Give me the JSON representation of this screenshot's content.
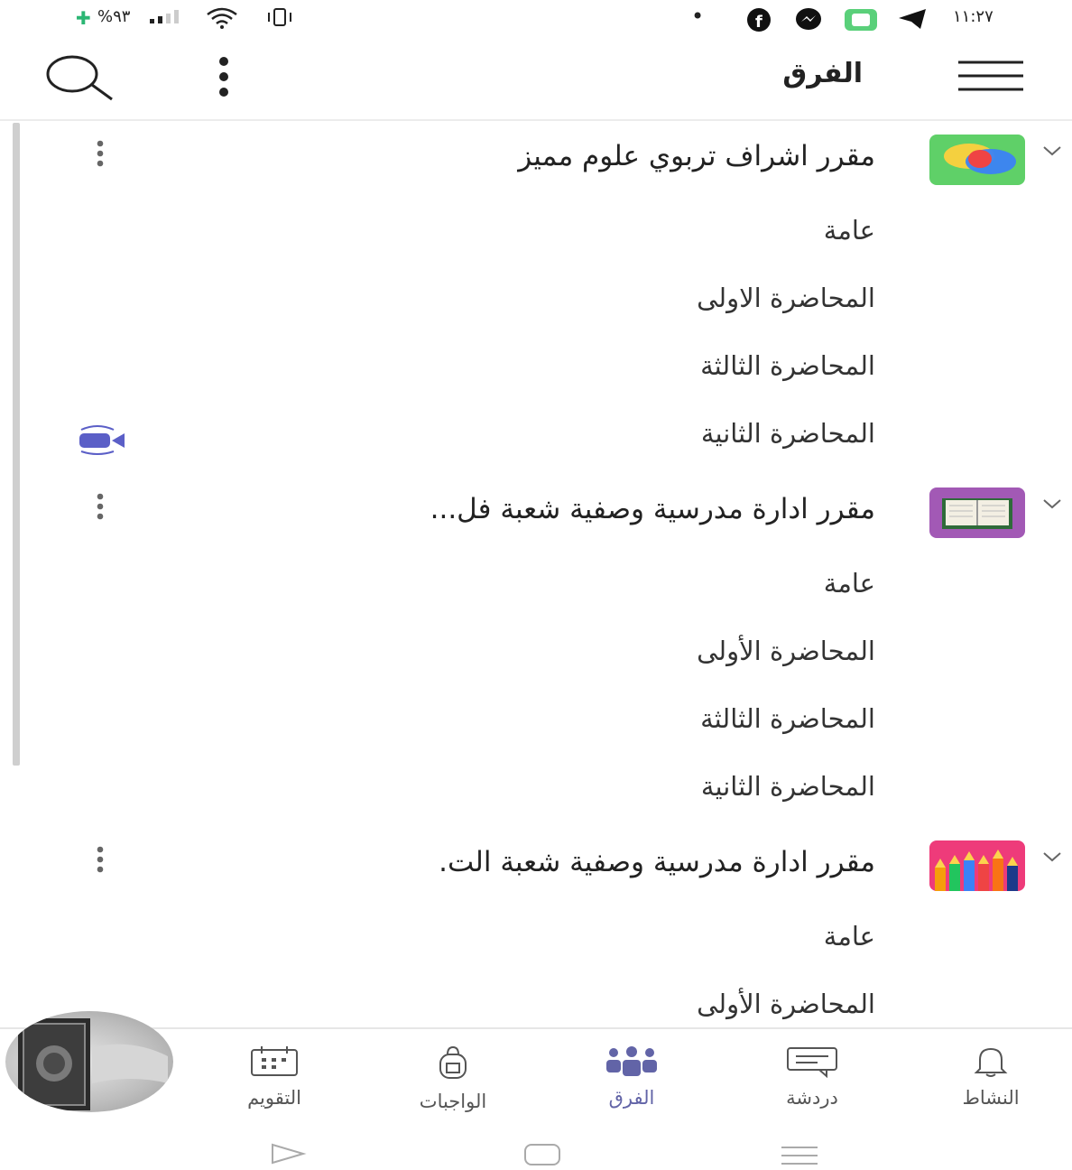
{
  "status_bar": {
    "time": "١١:٢٧",
    "battery": "%٩٣"
  },
  "header": {
    "title": "الفرق"
  },
  "teams": [
    {
      "name": "مقرر اشراف تربوي علوم مميز",
      "channels": [
        "عامة",
        "المحاضرة الاولى",
        "المحاضرة الثالثة",
        "المحاضرة الثانية"
      ]
    },
    {
      "name": "مقرر ادارة مدرسية وصفية شعبة فل...",
      "channels": [
        "عامة",
        "المحاضرة الأولى",
        "المحاضرة الثالثة",
        "المحاضرة الثانية"
      ]
    },
    {
      "name": "مقرر ادارة مدرسية وصفية شعبة الت.",
      "channels": [
        "عامة",
        "المحاضرة الأولى"
      ]
    }
  ],
  "bottom_nav": {
    "items": [
      {
        "label": "النشاط",
        "icon": "bell-icon"
      },
      {
        "label": "دردشة",
        "icon": "chat-icon"
      },
      {
        "label": "الفرق",
        "icon": "teams-icon",
        "active": true
      },
      {
        "label": "الواجبات",
        "icon": "assignments-icon"
      },
      {
        "label": "التقويم",
        "icon": "calendar-icon"
      }
    ]
  },
  "colors": {
    "accent": "#6264a7",
    "team1_logo_bg": "#5fd068",
    "team2_logo_bg": "#a259b5",
    "team3_logo_bg": "#ee3b7a"
  }
}
